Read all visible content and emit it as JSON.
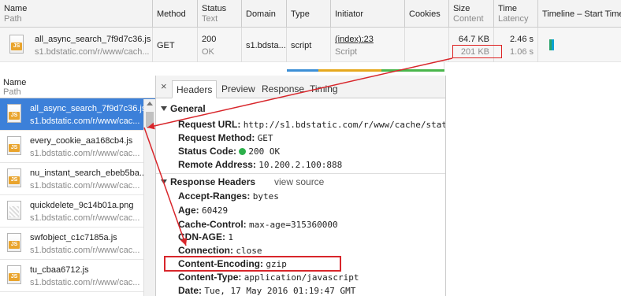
{
  "table": {
    "headers": {
      "name": "Name",
      "path": "Path",
      "method": "Method",
      "status": "Status",
      "status_text": "Text",
      "domain": "Domain",
      "type": "Type",
      "initiator": "Initiator",
      "cookies": "Cookies",
      "size": "Size",
      "content": "Content",
      "time": "Time",
      "latency": "Latency",
      "timeline": "Timeline – Start Time"
    },
    "row": {
      "name": "all_async_search_7f9d7c36.js",
      "path": "s1.bdstatic.com/r/www/cach...",
      "method": "GET",
      "status": "200",
      "status_text": "OK",
      "domain": "s1.bdsta...",
      "type": "script",
      "initiator": "(index):23",
      "initiator_sub": "Script",
      "size": "64.7 KB",
      "content": "201 KB",
      "time": "2.46 s",
      "latency": "1.06 s"
    }
  },
  "list": {
    "header_name": "Name",
    "header_path": "Path",
    "items": [
      {
        "name": "all_async_search_7f9d7c36.js",
        "path": "s1.bdstatic.com/r/www/cac...",
        "icon": "js"
      },
      {
        "name": "every_cookie_aa168cb4.js",
        "path": "s1.bdstatic.com/r/www/cac...",
        "icon": "js"
      },
      {
        "name": "nu_instant_search_ebeb5ba...",
        "path": "s1.bdstatic.com/r/www/cac...",
        "icon": "js"
      },
      {
        "name": "quickdelete_9c14b01a.png",
        "path": "s1.bdstatic.com/r/www/cac...",
        "icon": "png"
      },
      {
        "name": "swfobject_c1c7185a.js",
        "path": "s1.bdstatic.com/r/www/cac...",
        "icon": "js"
      },
      {
        "name": "tu_cbaa6712.js",
        "path": "s1.bdstatic.com/r/www/cac...",
        "icon": "js"
      }
    ]
  },
  "detail": {
    "close": "×",
    "tabs": [
      "Headers",
      "Preview",
      "Response",
      "Timing"
    ],
    "general_title": "General",
    "general": [
      {
        "k": "Request URL:",
        "v": "http://s1.bdstatic.com/r/www/cache/stat"
      },
      {
        "k": "Request Method:",
        "v": "GET"
      },
      {
        "k": "Status Code:",
        "v": "200 OK"
      },
      {
        "k": "Remote Address:",
        "v": "10.200.2.100:888"
      }
    ],
    "response_title": "Response Headers",
    "view_source": "view source",
    "response": [
      {
        "k": "Accept-Ranges:",
        "v": "bytes"
      },
      {
        "k": "Age:",
        "v": "60429"
      },
      {
        "k": "Cache-Control:",
        "v": "max-age=315360000"
      },
      {
        "k": "CDN-AGE:",
        "v": "1"
      },
      {
        "k": "Connection:",
        "v": "close"
      },
      {
        "k": "Content-Encoding:",
        "v": "gzip"
      },
      {
        "k": "Content-Type:",
        "v": "application/javascript"
      },
      {
        "k": "Date:",
        "v": "Tue, 17 May 2016 01:19:47 GMT"
      }
    ]
  },
  "colors": {
    "selected": "#3c80d9",
    "annotation": "#d8262b",
    "status_ok": "#2db04b",
    "js_badge": "#e9a42d"
  }
}
